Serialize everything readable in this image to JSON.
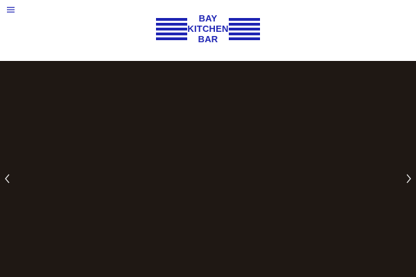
{
  "header": {
    "menu_icon": "hamburger-menu-icon",
    "logo": {
      "line1": "BAY",
      "line2": "KITCHEN",
      "line3": "BAR",
      "color": "#1f25b4"
    }
  },
  "hero": {
    "background_color": "#1f1814",
    "prev_icon": "chevron-left-icon",
    "next_icon": "chevron-right-icon"
  }
}
